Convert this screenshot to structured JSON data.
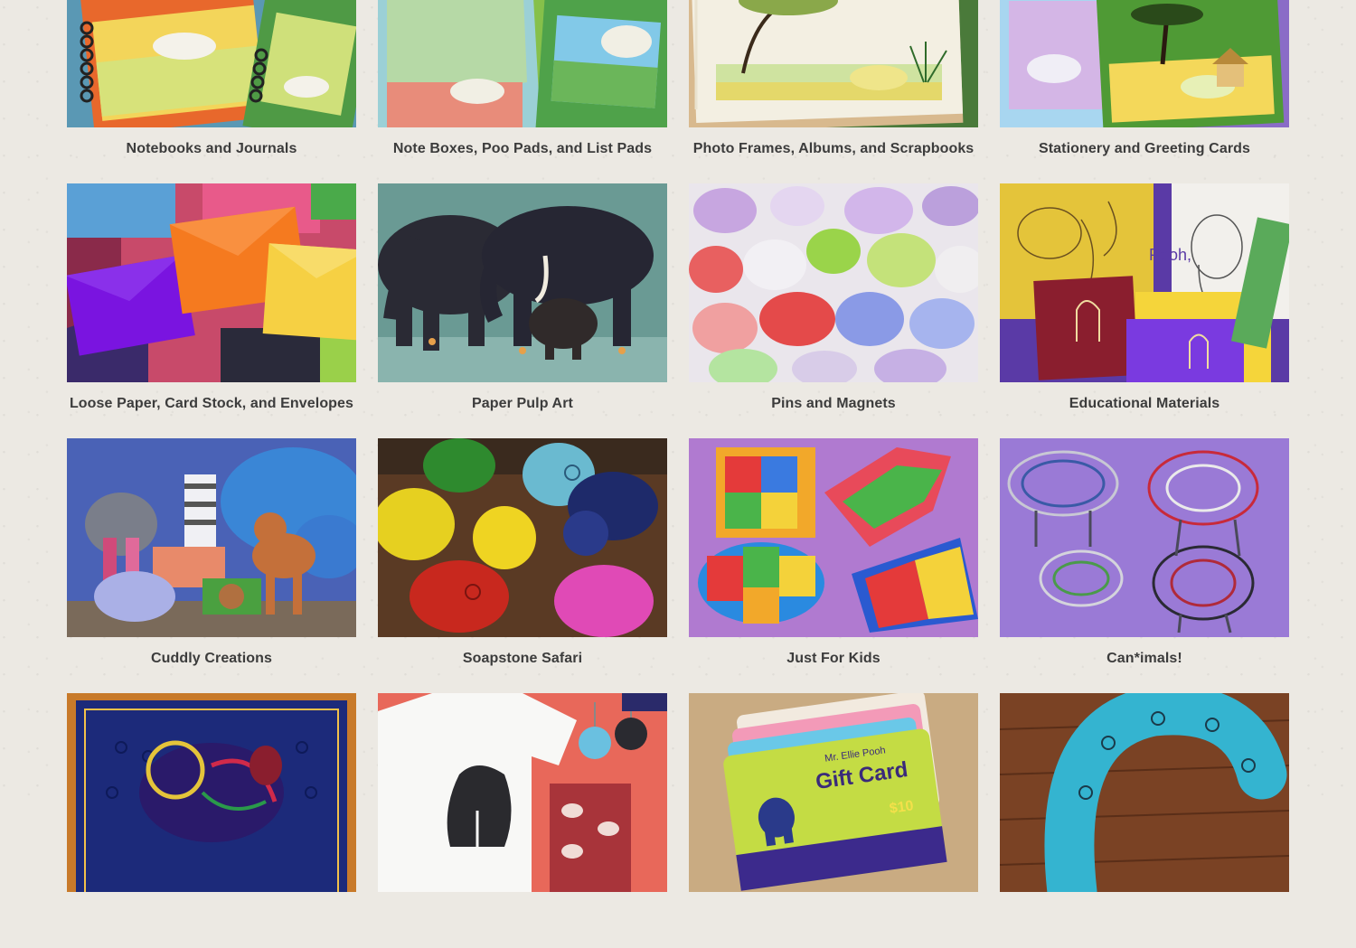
{
  "categories": [
    {
      "label": "Notebooks and Journals",
      "icon": "notebooks-image"
    },
    {
      "label": "Note Boxes, Poo Pads, and List Pads",
      "icon": "note-boxes-image"
    },
    {
      "label": "Photo Frames, Albums, and Scrapbooks",
      "icon": "photo-frames-image"
    },
    {
      "label": "Stationery and Greeting Cards",
      "icon": "stationery-image"
    },
    {
      "label": "Loose Paper, Card Stock, and Envelopes",
      "icon": "loose-paper-image"
    },
    {
      "label": "Paper Pulp Art",
      "icon": "paper-pulp-art-image"
    },
    {
      "label": "Pins and Magnets",
      "icon": "pins-magnets-image"
    },
    {
      "label": "Educational Materials",
      "icon": "educational-image"
    },
    {
      "label": "Cuddly Creations",
      "icon": "cuddly-creations-image"
    },
    {
      "label": "Soapstone Safari",
      "icon": "soapstone-safari-image"
    },
    {
      "label": "Just For Kids",
      "icon": "just-for-kids-image"
    },
    {
      "label": "Can*imals!",
      "icon": "canimals-image"
    },
    {
      "label": "",
      "icon": "rug-image"
    },
    {
      "label": "",
      "icon": "tshirt-image"
    },
    {
      "label": "",
      "icon": "gift-card-image"
    },
    {
      "label": "",
      "icon": "horseshoe-image"
    }
  ],
  "gift_card": {
    "brand": "Mr. Ellie Pooh",
    "title": "Gift Card",
    "amount": "$10"
  },
  "colors": {
    "background": "#ece9e3",
    "caption": "#3c3c3c"
  }
}
